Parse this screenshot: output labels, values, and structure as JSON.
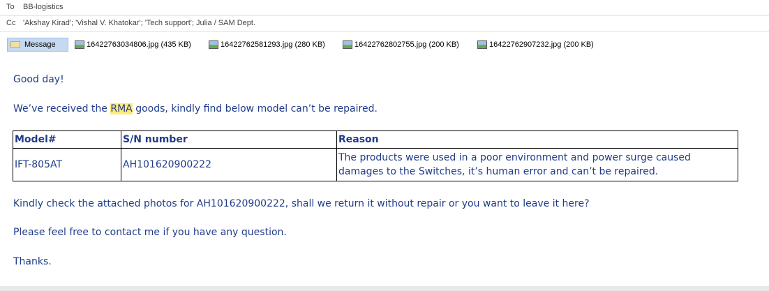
{
  "header": {
    "to_label": "To",
    "to_value": "BB-logistics",
    "cc_label": "Cc",
    "cc_value": "'Akshay Kirad'; 'Vishal V. Khatokar'; 'Tech support'; Julia / SAM Dept."
  },
  "attachments": {
    "message_label": "Message",
    "files": [
      "16422763034806.jpg (435 KB)",
      "16422762581293.jpg (280 KB)",
      "16422762802755.jpg (200 KB)",
      "16422762907232.jpg (200 KB)"
    ]
  },
  "body": {
    "greeting": "Good day!",
    "intro_before": "We’ve received the ",
    "intro_highlight": "RMA",
    "intro_after": " goods, kindly find below model can’t be repaired.",
    "table": {
      "headers": [
        "Model#",
        "S/N number",
        "Reason"
      ],
      "rows": [
        [
          "IFT-805AT",
          "AH101620900222",
          "The products were used in a poor environment and power surge caused damages to the Switches, it’s human error and can’t be repaired."
        ]
      ]
    },
    "check_line": "Kindly check the attached photos for AH101620900222, shall we return it without repair or you want to leave it here?",
    "contact_line": "Please feel free to contact me if you have any question.",
    "thanks": "Thanks."
  },
  "colors": {
    "body_text": "#1f3b8a",
    "highlight": "#ffe97a",
    "message_tab": "#c5d9f1"
  }
}
